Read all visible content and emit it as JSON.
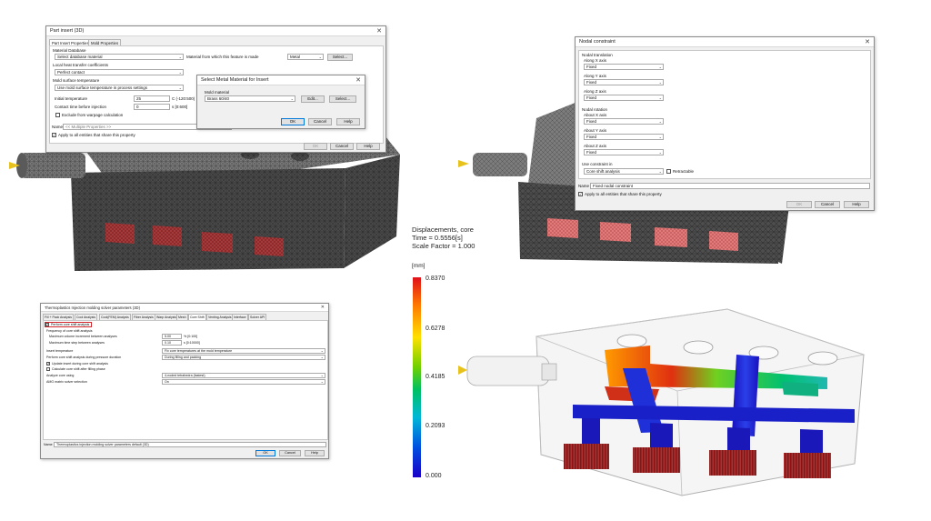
{
  "part_insert": {
    "title": "Part insert (3D)",
    "tabs": [
      "Part Insert Properties",
      "Mold Properties"
    ],
    "material_database_label": "Material Database",
    "material_db_value": "Select database material",
    "material_made_label": "Material from which this feature is made",
    "material_type_value": "Metal",
    "select_label": "Select...",
    "htc_label": "Local heat transfer coefficients",
    "htc_value": "Perfect contact",
    "mold_surface_label": "Mold surface temperature",
    "mold_surface_value": "Use mold surface temperature in process settings",
    "initial_temp_label": "Initial temperature",
    "initial_temp_value": "25",
    "initial_temp_range": "C (-120:500)",
    "contact_time_label": "Contact time before injection",
    "contact_time_value": "0",
    "contact_time_range": "s [0:600]",
    "exclude_label": "Exclude from warpage calculation",
    "name_label": "Name",
    "name_value": "<< Multiple Properties >>",
    "apply_label": "Apply to all entities that share this property",
    "ok": "OK",
    "cancel": "Cancel",
    "help": "Help"
  },
  "select_metal": {
    "title": "Select Metal Material for Insert",
    "mold_material_label": "Mold material",
    "mold_material_value": "Brass 60/40",
    "edit": "Edit...",
    "select": "Select...",
    "ok": "OK",
    "cancel": "Cancel",
    "help": "Help"
  },
  "nodal": {
    "title": "Nodal constraint",
    "translation_label": "Nodal translation",
    "rotation_label": "Nodal rotation",
    "rows_translation": [
      {
        "label": "Along X axis",
        "value": "Fixed"
      },
      {
        "label": "Along Y axis",
        "value": "Fixed"
      },
      {
        "label": "Along Z axis",
        "value": "Fixed"
      }
    ],
    "rows_rotation": [
      {
        "label": "About X axis",
        "value": "Fixed"
      },
      {
        "label": "About Y axis",
        "value": "Fixed"
      },
      {
        "label": "About Z axis",
        "value": "Fixed"
      }
    ],
    "use_in_label": "Use constraint in",
    "use_in_value": "Core shift analysis",
    "retractable": "Retractable",
    "name_label": "Name",
    "name_value": "Fixed nodal constraint",
    "apply_label": "Apply to all entities that share this property",
    "ok": "OK",
    "cancel": "Cancel",
    "help": "Help"
  },
  "solver": {
    "title": "Thermoplastics Injection molding solver parameters (3D)",
    "tabs": [
      "Fill + Pack Analysis",
      "Cool Analysis",
      "Cool(FEM) Analysis",
      "Fiber Analysis",
      "Warp Analysis",
      "Mesh",
      "Core Shift",
      "Venting Analysis",
      "Interface",
      "Solver API"
    ],
    "perform_core_shift": "Perform core shift analysis",
    "frequency_label": "Frequency of core shift analysis",
    "max_volume_label": "Maximum volume increment between analyses",
    "max_volume_value": "5.00",
    "max_volume_range": "% [0:100]",
    "max_time_label": "Maximum time step between analyses",
    "max_time_value": "0.10",
    "max_time_range": "s [0:10000]",
    "insert_temp_label": "Insert temperature",
    "insert_temp_value": "Fix core temperatures at the mold temperature",
    "perform_during_label": "Perform core shift analysis during pressure duration",
    "perform_during_value": "During filling and packing",
    "update_insert": "Update insert during core shift analysis",
    "calc_after_fill": "Calculate core shift after filling phase",
    "analyze_label": "Analyze core using",
    "analyze_value": "4-noded tetrahedra (fastest)",
    "amg_label": "AMG matrix solver selection",
    "amg_value": "On",
    "name_label": "Name",
    "name_value": "Thermoplastics injection molding solver parameters default (3D)",
    "ok": "OK",
    "cancel": "Cancel",
    "help": "Help"
  },
  "result": {
    "line1": "Displacements, core",
    "line2": "Time = 0.5556[s]",
    "line3": "Scale Factor = 1.000",
    "unit": "[mm]",
    "ticks": [
      "0.8370",
      "0.6278",
      "0.4185",
      "0.2093",
      "0.000"
    ]
  }
}
